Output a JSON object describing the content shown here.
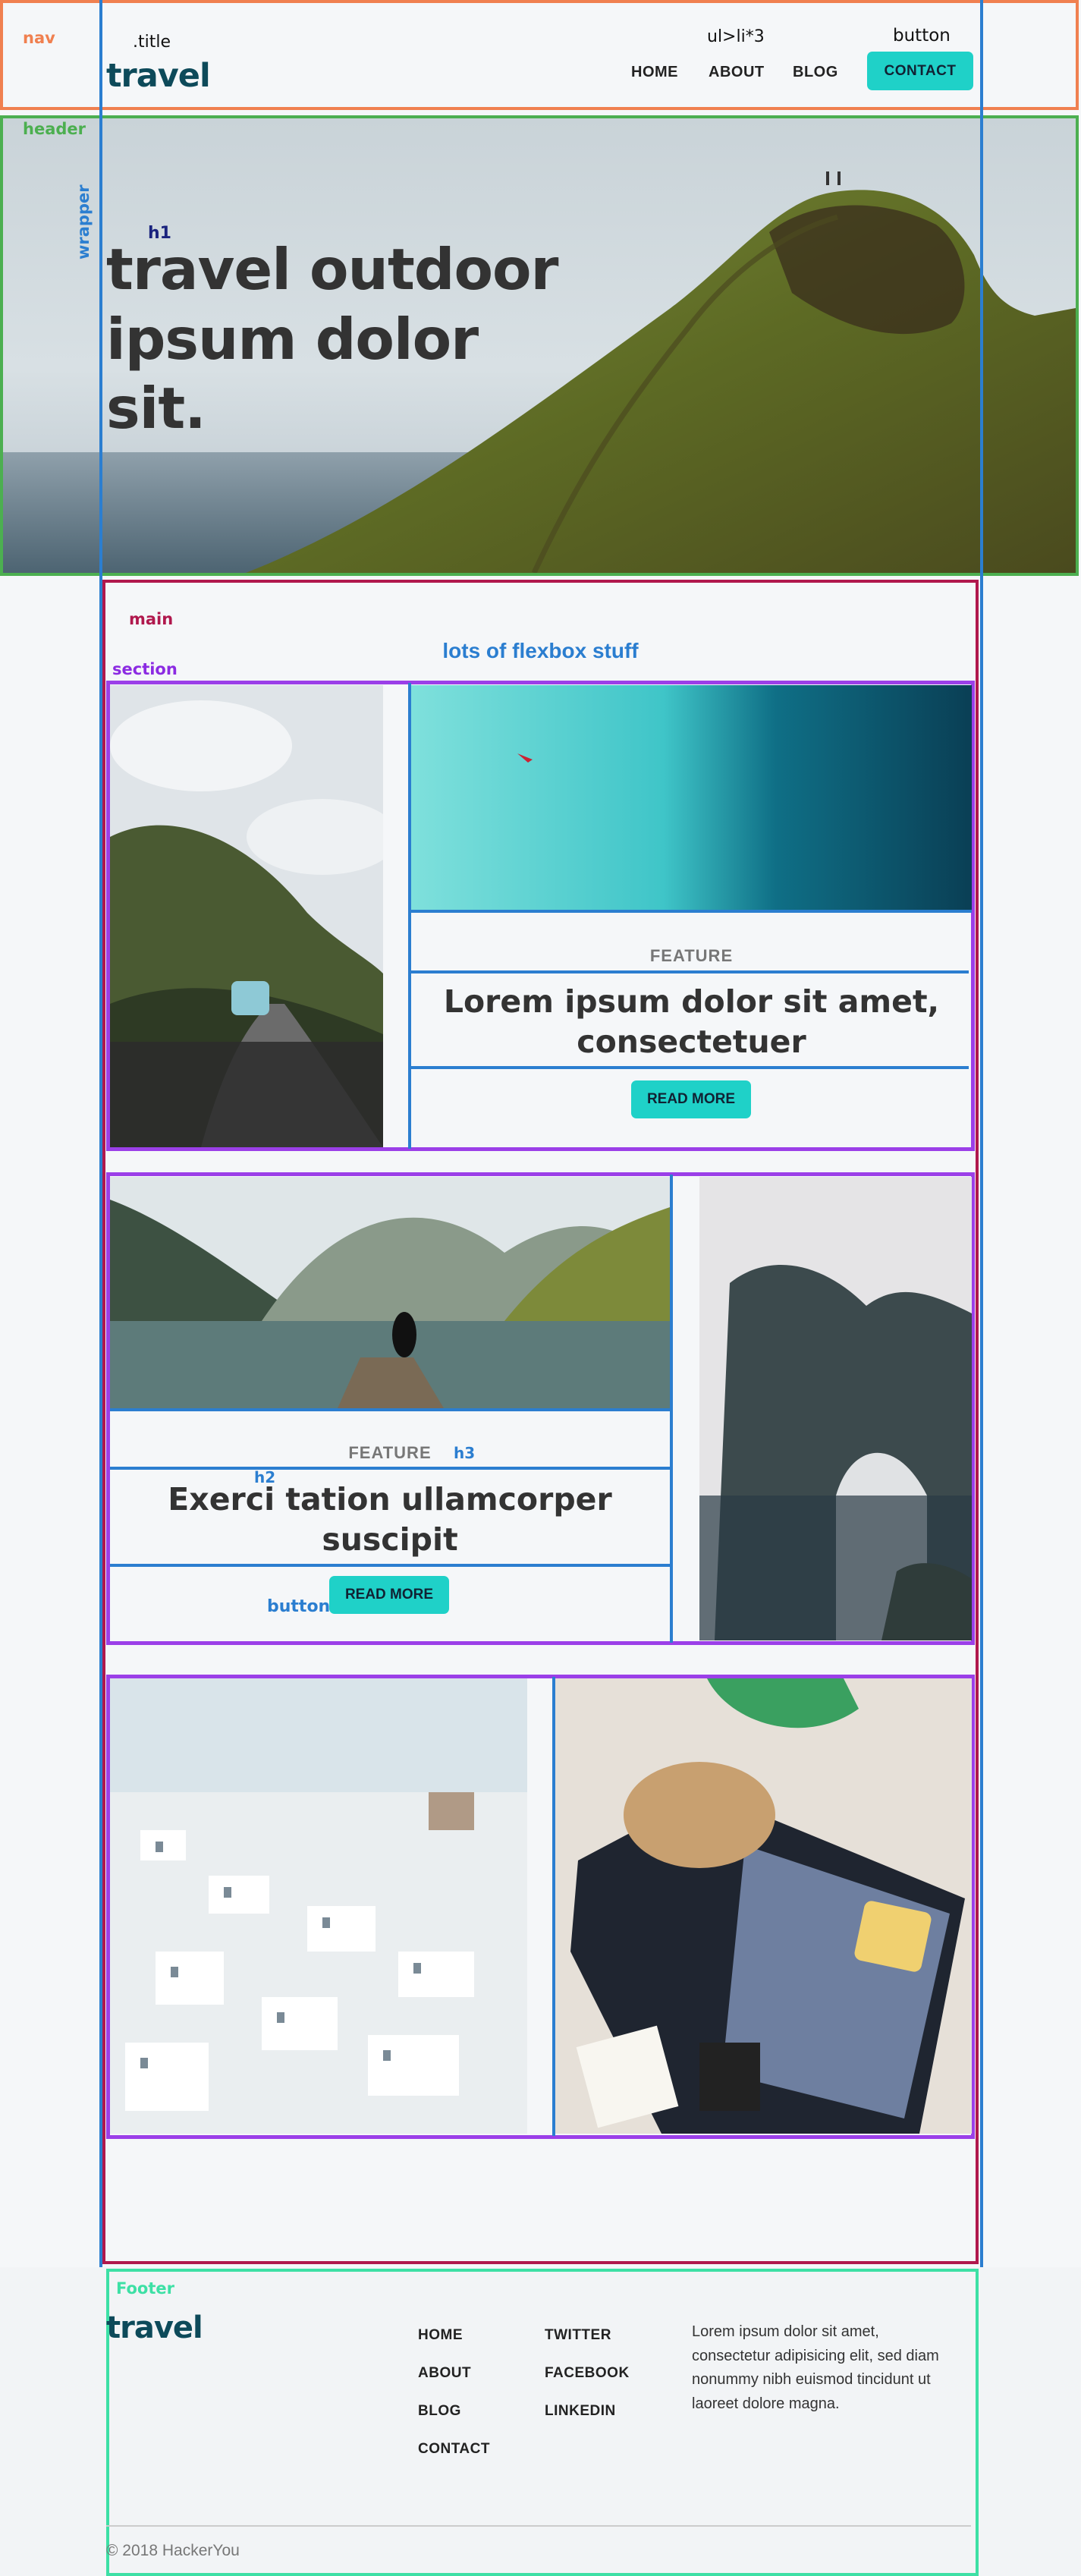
{
  "debug_labels": {
    "nav": "nav",
    "title": ".title",
    "ul": "ul>li*3",
    "button_top": "button",
    "header": "header",
    "wrapper": "wrapper",
    "h1": "h1",
    "main": "main",
    "section": "section",
    "h2": "h2",
    "h3": "h3",
    "button_card": "button",
    "footer": "Footer"
  },
  "nav": {
    "brand": "travel",
    "links": [
      "HOME",
      "ABOUT",
      "BLOG"
    ],
    "contact": "CONTACT"
  },
  "hero": {
    "title": "travel outdoor ipsum dolor sit."
  },
  "main": {
    "heading": "lots of flexbox stuff",
    "card1": {
      "eyebrow": "FEATURE",
      "title": "Lorem ipsum dolor sit amet, consectetuer",
      "button": "READ MORE"
    },
    "card2": {
      "eyebrow": "FEATURE",
      "title": "Exerci tation ullamcorper suscipit",
      "button": "READ MORE"
    }
  },
  "footer": {
    "brand": "travel",
    "col1": [
      "HOME",
      "ABOUT",
      "BLOG",
      "CONTACT"
    ],
    "col2": [
      "TWITTER",
      "FACEBOOK",
      "LINKEDIN"
    ],
    "text": "Lorem ipsum dolor sit amet, consectetur adipisicing elit, sed diam nonummy nibh euismod tincidunt ut laoreet dolore magna.",
    "copyright": "© 2018 HackerYou"
  },
  "colors": {
    "accent": "#1fd1c8",
    "brand": "#0d4a5a",
    "nav_outline": "#f08050",
    "header_outline": "#4caf50",
    "wrapper_outline": "#2b7ed0",
    "main_outline": "#b0184d",
    "section_outline": "#9b3fe8",
    "footer_outline": "#3de0a5"
  }
}
